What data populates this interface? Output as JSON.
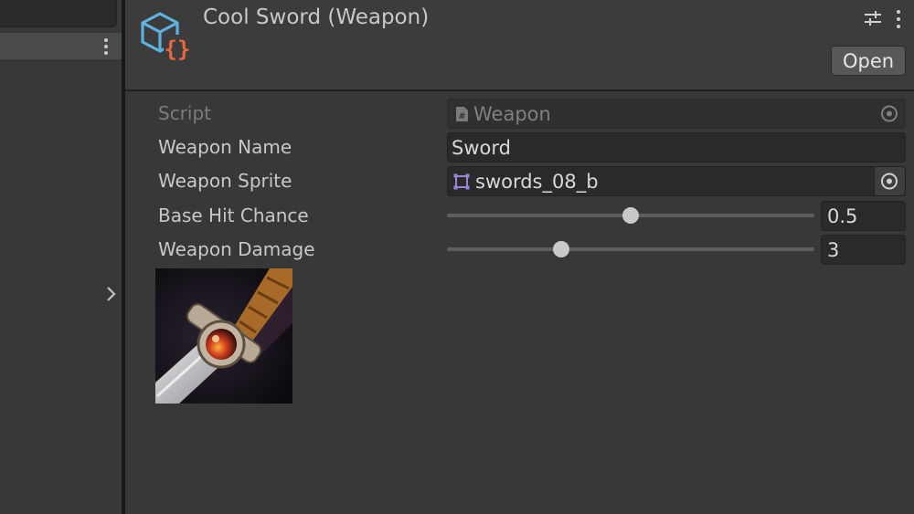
{
  "header": {
    "title": "Cool Sword (Weapon)",
    "open_label": "Open",
    "icon": "scriptable-object-icon"
  },
  "properties": {
    "script": {
      "label": "Script",
      "value": "Weapon"
    },
    "weapon_name": {
      "label": "Weapon Name",
      "value": "Sword"
    },
    "weapon_sprite": {
      "label": "Weapon Sprite",
      "value": "swords_08_b"
    },
    "base_hit_chance": {
      "label": "Base Hit Chance",
      "value": "0.5",
      "slider_fraction": 0.5
    },
    "weapon_damage": {
      "label": "Weapon Damage",
      "value": "3",
      "slider_fraction": 0.31
    }
  },
  "colors": {
    "background": "#383838",
    "icon_blue": "#5fb2e0",
    "icon_orange": "#e8683a",
    "sprite_icon": "#9b84d8"
  }
}
